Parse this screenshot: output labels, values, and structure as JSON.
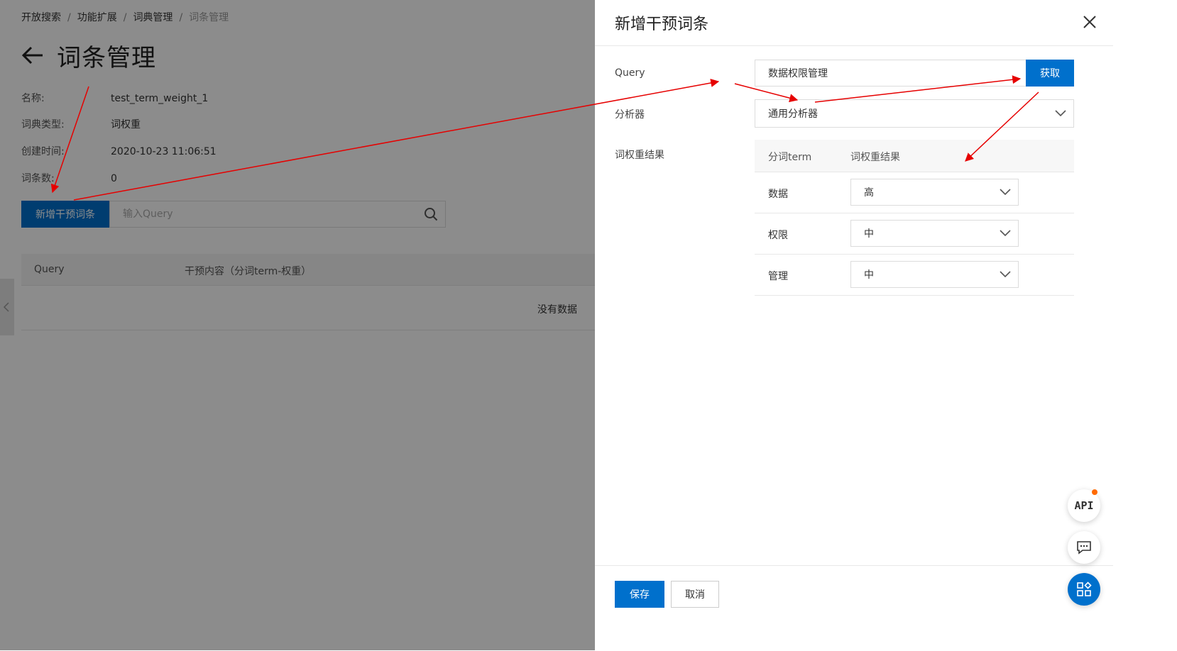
{
  "breadcrumb": [
    "开放搜索",
    "功能扩展",
    "词典管理",
    "词条管理"
  ],
  "page": {
    "title": "词条管理",
    "info": [
      {
        "key": "名称:",
        "value": "test_term_weight_1"
      },
      {
        "key": "词典类型:",
        "value": "词权重"
      },
      {
        "key": "创建时间:",
        "value": "2020-10-23 11:06:51"
      },
      {
        "key": "词条数:",
        "value": "0"
      }
    ],
    "add_button": "新增干预词条",
    "search_placeholder": "输入Query",
    "table": {
      "columns": [
        "Query",
        "干预内容（分词term-权重）"
      ],
      "empty_text": "没有数据"
    }
  },
  "drawer": {
    "title": "新增干预词条",
    "query_label": "Query",
    "query_value": "数据权限管理",
    "fetch_button": "获取",
    "analyzer_label": "分析器",
    "analyzer_value": "通用分析器",
    "result_label": "词权重结果",
    "result_columns": [
      "分词term",
      "词权重结果"
    ],
    "results": [
      {
        "term": "数据",
        "weight": "高"
      },
      {
        "term": "权限",
        "weight": "中"
      },
      {
        "term": "管理",
        "weight": "中"
      }
    ],
    "save_button": "保存",
    "cancel_button": "取消"
  },
  "floating": {
    "api_label": "API"
  },
  "colors": {
    "primary": "#0070cc",
    "annotation": "#e60000",
    "badge": "#ff6a00"
  }
}
